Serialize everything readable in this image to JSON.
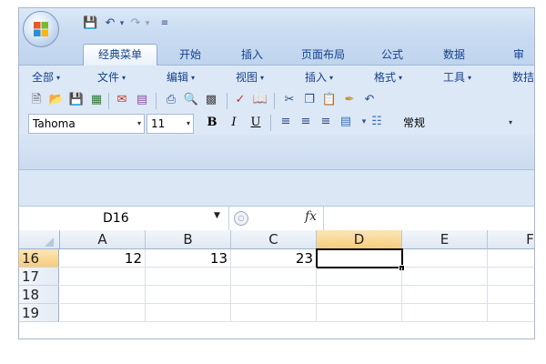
{
  "quick_access": {
    "save_icon": "save-icon",
    "undo_icon": "undo-icon",
    "redo_icon": "redo-icon",
    "customize_icon": "customize-icon"
  },
  "tabs": [
    "经典菜单",
    "开始",
    "插入",
    "页面布局",
    "公式",
    "数据",
    "审"
  ],
  "menus": [
    "全部",
    "文件",
    "编辑",
    "视图",
    "插入",
    "格式",
    "工具",
    "数拮"
  ],
  "font": {
    "name": "Tahoma",
    "size": "11"
  },
  "format_buttons": {
    "bold": "B",
    "italic": "I",
    "underline": "U"
  },
  "number_format": "常规",
  "formula_bar": {
    "name_box": "D16",
    "fx": "fx",
    "formula": ""
  },
  "columns": [
    "A",
    "B",
    "C",
    "D",
    "E",
    "F"
  ],
  "rows": [
    {
      "label": "16",
      "cells": [
        "12",
        "13",
        "23",
        "",
        "",
        ""
      ]
    },
    {
      "label": "17",
      "cells": [
        "",
        "",
        "",
        "",
        "",
        ""
      ]
    },
    {
      "label": "18",
      "cells": [
        "",
        "",
        "",
        "",
        "",
        ""
      ]
    },
    {
      "label": "19",
      "cells": [
        "",
        "",
        "",
        "",
        "",
        ""
      ]
    }
  ],
  "selected_cell": "D16",
  "colors": {
    "accent": "#15428b",
    "selected_header": "#f7cd7d"
  }
}
